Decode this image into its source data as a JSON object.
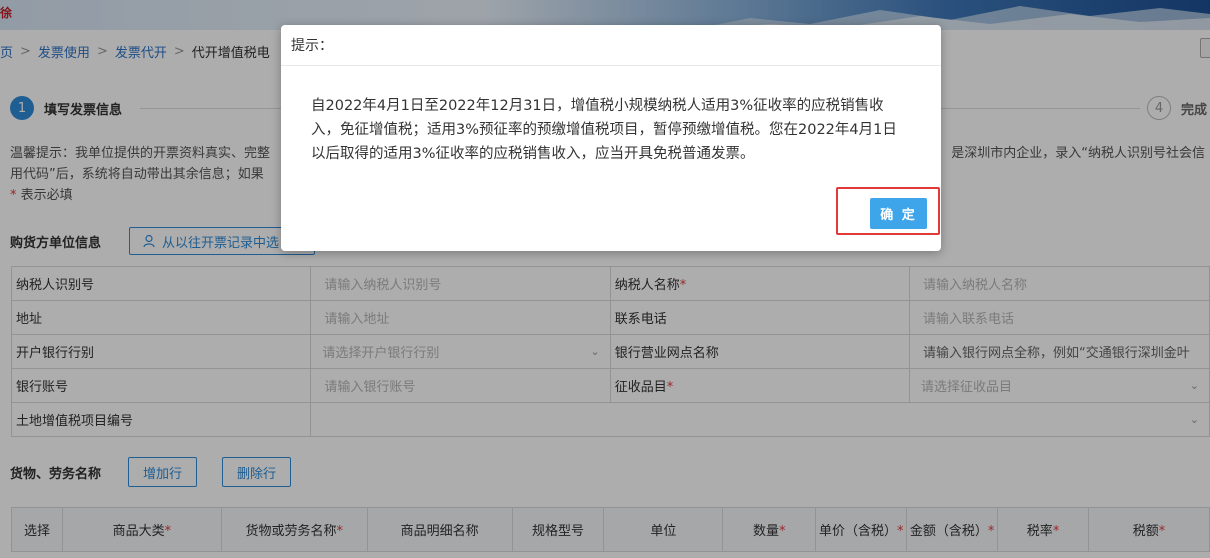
{
  "banner": {
    "logo_text": "徐"
  },
  "breadcrumb": {
    "items": [
      "页",
      "发票使用",
      "发票代开",
      "代开增值税电"
    ],
    "separator": ">"
  },
  "steps": {
    "step1": {
      "number": "1",
      "label": "填写发票信息"
    },
    "step4": {
      "number": "4",
      "label": "完成"
    }
  },
  "notice": {
    "line1_start": "温馨提示：我单位提供的开票资料真实、完整",
    "line1_end": "是深圳市内企业，录入“纳税人识别号社会信",
    "line2_start": "用代码”后，系统将自动带出其余信息；如果",
    "required_mark": "*",
    "required_text": " 表示必填"
  },
  "buyer": {
    "title": "购货方单位信息",
    "history_button": "从以往开票记录中选",
    "rows": [
      [
        {
          "label": "纳税人识别号",
          "required": false
        },
        {
          "placeholder": "请输入纳税人识别号"
        },
        {
          "label": "纳税人名称",
          "required": true
        },
        {
          "placeholder": "请输入纳税人名称"
        }
      ],
      [
        {
          "label": "地址",
          "required": false
        },
        {
          "placeholder": "请输入地址"
        },
        {
          "label": "联系电话",
          "required": false
        },
        {
          "placeholder": "请输入联系电话"
        }
      ],
      [
        {
          "label": "开户银行行别",
          "required": false
        },
        {
          "placeholder": "请选择开户银行行别",
          "select": true
        },
        {
          "label": "银行营业网点名称",
          "required": false
        },
        {
          "placeholder": "请输入银行网点全称，例如“交通银行深圳金叶"
        }
      ],
      [
        {
          "label": "银行账号",
          "required": false
        },
        {
          "placeholder": "请输入银行账号"
        },
        {
          "label": "征收品目",
          "required": true
        },
        {
          "placeholder": "请选择征收品目",
          "select": true
        }
      ]
    ],
    "land_vat_label": "土地增值税项目编号"
  },
  "goods": {
    "title": "货物、劳务名称",
    "add_button": "增加行",
    "delete_button": "删除行",
    "columns": [
      {
        "label": "选择",
        "required": false
      },
      {
        "label": "商品大类",
        "required": true
      },
      {
        "label": "货物或劳务名称",
        "required": true
      },
      {
        "label": "商品明细名称",
        "required": false
      },
      {
        "label": "规格型号",
        "required": false
      },
      {
        "label": "单位",
        "required": false
      },
      {
        "label": "数量",
        "required": true
      },
      {
        "label": "单价（含税）",
        "required": true
      },
      {
        "label": "金额（含税）",
        "required": true
      },
      {
        "label": "税率",
        "required": true
      },
      {
        "label": "税额",
        "required": true
      }
    ]
  },
  "dialog": {
    "title": "提示：",
    "message": "自2022年4月1日至2022年12月31日，增值税小规模纳税人适用3%征收率的应税销售收入，免征增值税；适用3%预征率的预缴增值税项目，暂停预缴增值税。您在2022年4月1日以后取得的适用3%征收率的应税销售收入，应当开具免税普通发票。",
    "ok_button": "确 定"
  },
  "colors": {
    "accent": "#2e8bd7",
    "required": "#e23a3a",
    "highlight_box": "#e23a3a",
    "ok_button": "#3fa5ea"
  }
}
